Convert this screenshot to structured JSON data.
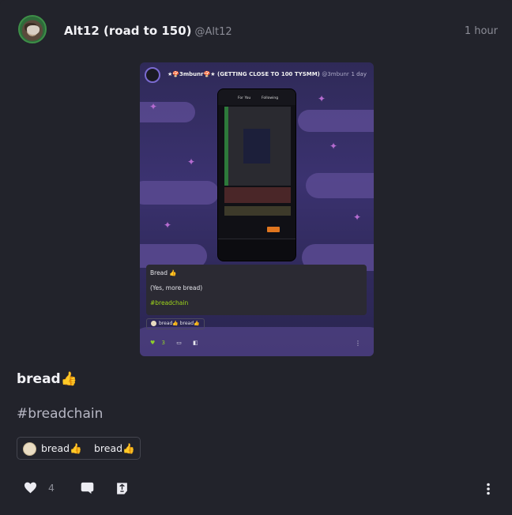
{
  "post": {
    "author_name": "Alt12 (road to 150)",
    "author_handle": "@Alt12",
    "timestamp": "1 hour",
    "body": "bread👍",
    "hashtag": "#breadchain",
    "reactions": [
      {
        "label": "bread👍",
        "with_avatar": true
      },
      {
        "label": "bread👍",
        "with_avatar": false
      }
    ],
    "like_count": "4"
  },
  "embed": {
    "author_name": "★🍄3mbunr🍄★ (GETTING CLOSE TO 100 TYSMM)",
    "author_handle": "@3mbunr",
    "timestamp": "1 day",
    "phone_tabs": [
      "For You",
      "Following"
    ],
    "text_lines": [
      "Bread 👍",
      "(Yes, more bread)",
      "#breadchain"
    ],
    "reactions": "bread👍 bread👍",
    "like_count": "3"
  },
  "icons": [
    "heart-icon",
    "reply-icon",
    "repost-icon",
    "more-icon"
  ],
  "colors": {
    "background": "#22232b",
    "accent_green": "#9fd71a",
    "muted": "#8b8c96"
  }
}
